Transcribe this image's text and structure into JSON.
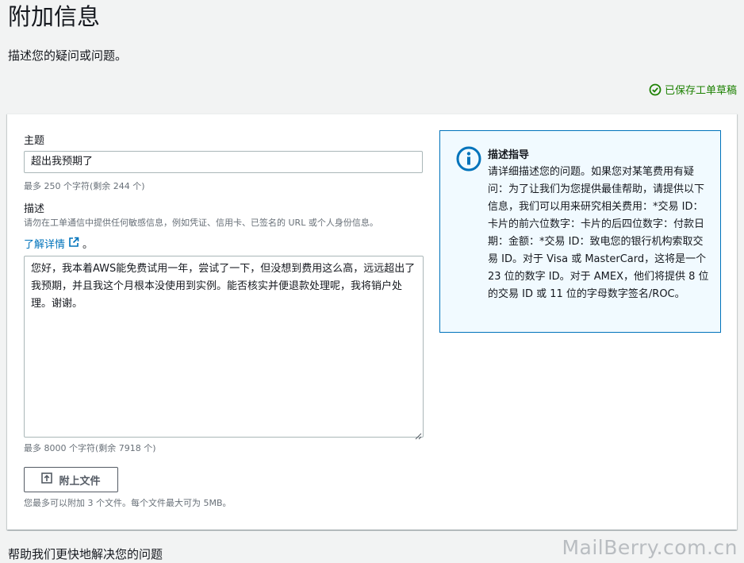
{
  "page": {
    "title": "附加信息",
    "subtitle": "描述您的疑问或问题。",
    "saved_status": "已保存工单草稿"
  },
  "form": {
    "subject_label": "主题",
    "subject_value": "超出我预期了",
    "subject_hint": "最多 250 个字符(剩余 244 个)",
    "description_label": "描述",
    "description_warning": "请勿在工单通信中提供任何敏感信息，例如凭证、信用卡、已签名的 URL 或个人身份信息。",
    "learn_more_label": "了解详情",
    "learn_more_suffix": "。",
    "description_value": "您好，我本着AWS能免费试用一年，尝试了一下，但没想到费用这么高，远远超出了我预期，并且我这个月根本没使用到实例。能否核实并便退款处理呢，我将销户处理。谢谢。",
    "description_hint": "最多 8000 个字符(剩余 7918 个)",
    "attach_label": "附上文件",
    "attach_hint": "您最多可以附加 3 个文件。每个文件最大可为 5MB。"
  },
  "guide": {
    "title": "描述指导",
    "text": "请详细描述您的问题。如果您对某笔费用有疑问：为了让我们为您提供最佳帮助，请提供以下信息，我们可以用来研究相关费用：*交易 ID：卡片的前六位数字：卡片的后四位数字：付款日期：金额：*交易 ID：致电您的银行机构索取交易 ID。对于 Visa 或 MasterCard，这将是一个 23 位的数字 ID。对于 AMEX，他们将提供 8 位的交易 ID 或 11 位的字母数字签名/ROC。"
  },
  "next_section": {
    "title": "帮助我们更快地解决您的问题"
  },
  "watermark": "MailBerry.com.cn",
  "colors": {
    "link": "#0073bb",
    "success": "#1d8102",
    "info_border": "#0073bb",
    "info_background": "#f1faff",
    "page_background": "#f2f3f3"
  },
  "icons": {
    "saved": "check-circle-icon",
    "external_link": "external-link-icon",
    "upload": "upload-icon",
    "info": "info-icon"
  }
}
